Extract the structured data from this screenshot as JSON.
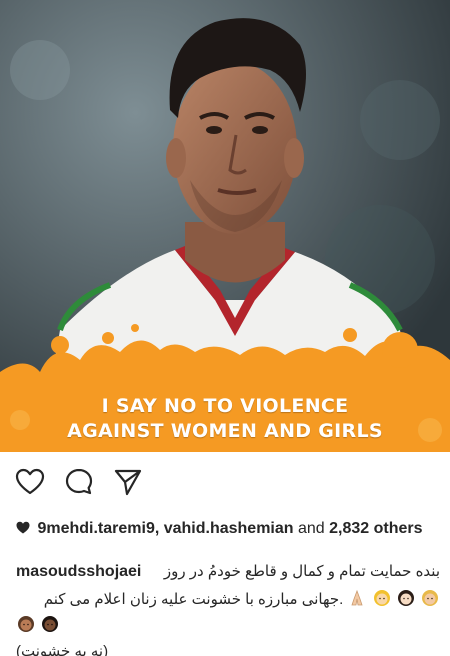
{
  "post": {
    "banner_line_1": "I SAY NO TO VIOLENCE",
    "banner_line_2": "AGAINST WOMEN AND GIRLS",
    "banner_color": "#f59a23"
  },
  "actions": {
    "like_icon": "heart-outline-icon",
    "comment_icon": "speech-bubble-icon",
    "share_icon": "paper-plane-icon"
  },
  "likes": {
    "icon": "heart-filled-icon",
    "users": "9mehdi.taremi9, vahid.hashemian",
    "conjunction": "and",
    "count": "2,832",
    "others_label": "others"
  },
  "caption": {
    "username": "masoudsshojaei",
    "line_1": "بنده حمایت تمام و کمال و قاطع خودمُ در روز",
    "line_2": ".جهانی مبارزه با خشونت علیه زنان اعلام می کنم",
    "line_4": "(نه به خشونت)",
    "emojis_line_2": [
      "woman-emoji",
      "woman-emoji",
      "woman-emoji",
      "pray-emoji"
    ],
    "emojis_line_3": [
      "woman-emoji",
      "woman-emoji"
    ]
  }
}
